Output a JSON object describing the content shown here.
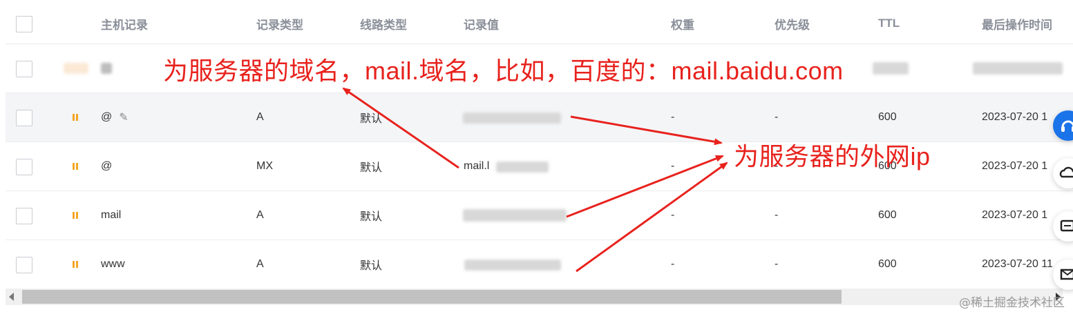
{
  "table": {
    "columns": [
      "主机记录",
      "记录类型",
      "线路类型",
      "记录值",
      "权重",
      "优先级",
      "TTL",
      "最后操作时间"
    ],
    "rows": [
      {
        "host": "@",
        "type": "A",
        "line": "默认",
        "value": "",
        "weight": "-",
        "priority": "-",
        "ttl": "600",
        "time": "2023-07-20 1"
      },
      {
        "host": "@",
        "type": "MX",
        "line": "默认",
        "value": "mail.l",
        "weight": "-",
        "priority": "-",
        "ttl": "600",
        "time": "2023-07-20 1"
      },
      {
        "host": "mail",
        "type": "A",
        "line": "默认",
        "value": "",
        "weight": "-",
        "priority": "-",
        "ttl": "600",
        "time": "2023-07-20 1"
      },
      {
        "host": "www",
        "type": "A",
        "line": "默认",
        "value": "",
        "weight": "-",
        "priority": "-",
        "ttl": "600",
        "time": "2023-07-20 11"
      }
    ]
  },
  "annotations": {
    "domain_note": "为服务器的域名，mail.域名，比如，百度的：mail.baidu.com",
    "ip_note": "为服务器的外网ip"
  },
  "watermark": "@稀土掘金技术社区",
  "icons": [
    "edit-pencil-icon",
    "pause-status-icon",
    "headset-icon",
    "cloud-icon",
    "message-icon",
    "mail-icon"
  ],
  "colors": {
    "annotation": "#e8221d",
    "pause": "#f5a623",
    "fab": "#1a73e8"
  }
}
